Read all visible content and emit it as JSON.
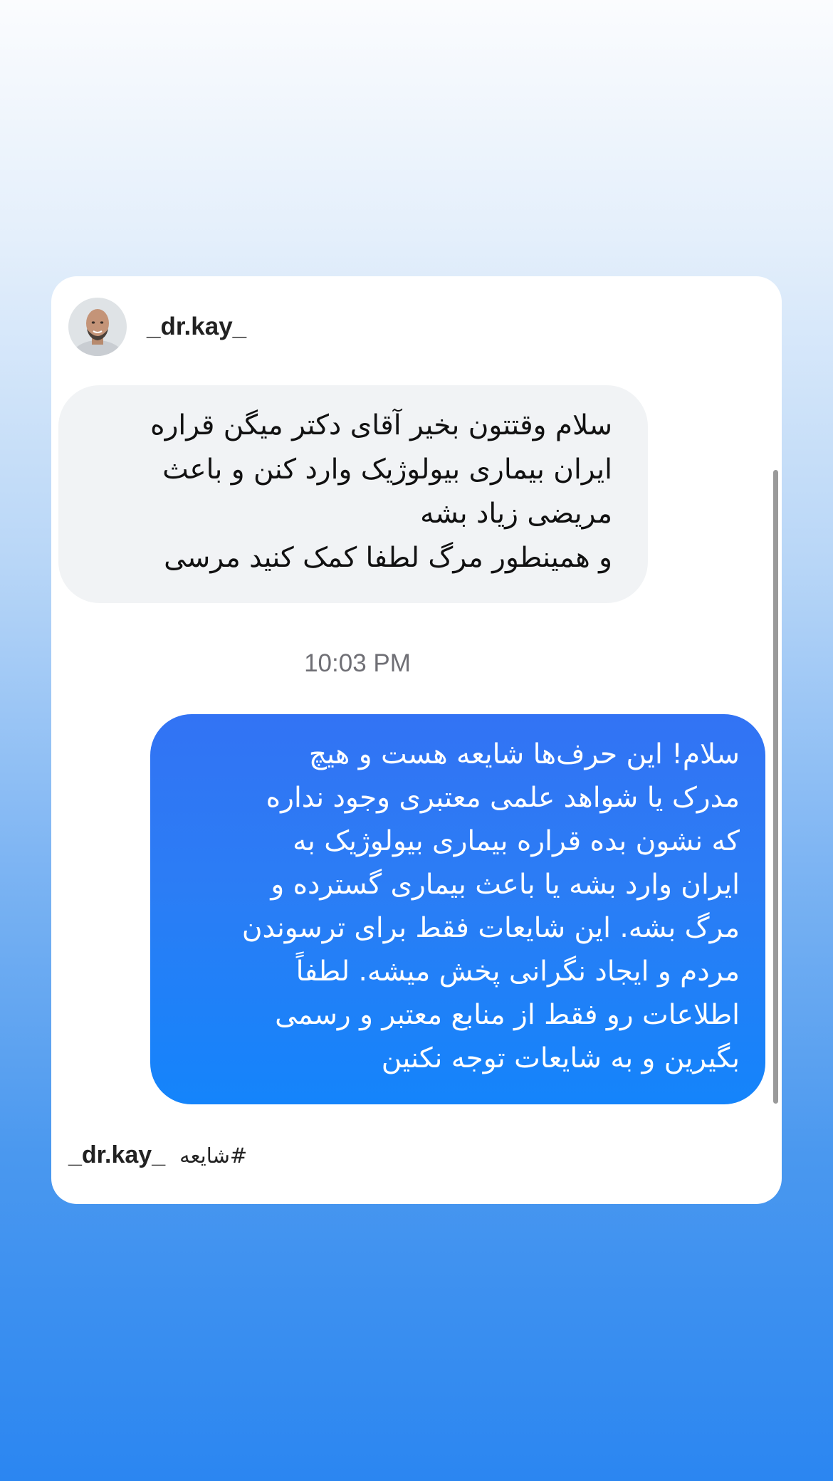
{
  "post": {
    "username": "_dr.kay_",
    "avatar_icon": "profile-photo-avatar"
  },
  "chat": {
    "incoming": {
      "lines": [
        "سلام وقتتون بخیر  آقای دکتر میگن قراره",
        "ایران بیماری بیولوژیک وارد کنن و باعث",
        "مریضی زیاد بشه",
        "و همینطور مرگ لطفا کمک کنید مرسی"
      ],
      "background_color": "#f1f3f5"
    },
    "timestamp": "10:03 PM",
    "outgoing": {
      "lines": [
        "سلام! این حرف‌ها شایعه هست و هیچ",
        "مدرک یا شواهد علمی معتبری وجود نداره",
        "که نشون بده قراره بیماری بیولوژیک به",
        "ایران وارد بشه یا باعث بیماری گسترده و",
        "مرگ بشه. این شایعات فقط برای ترسوندن",
        "مردم و ایجاد نگرانی پخش میشه. لطفاً",
        "اطلاعات رو فقط از منابع معتبر و رسمی",
        "بگیرین و به شایعات توجه نکنین"
      ],
      "background_color": "#2b7df5"
    }
  },
  "footer": {
    "username": "_dr.kay_",
    "hashtag": "#شایعه"
  },
  "colors": {
    "background_top": "#fbfcfe",
    "background_bottom": "#2b86f1",
    "card": "#ffffff"
  }
}
